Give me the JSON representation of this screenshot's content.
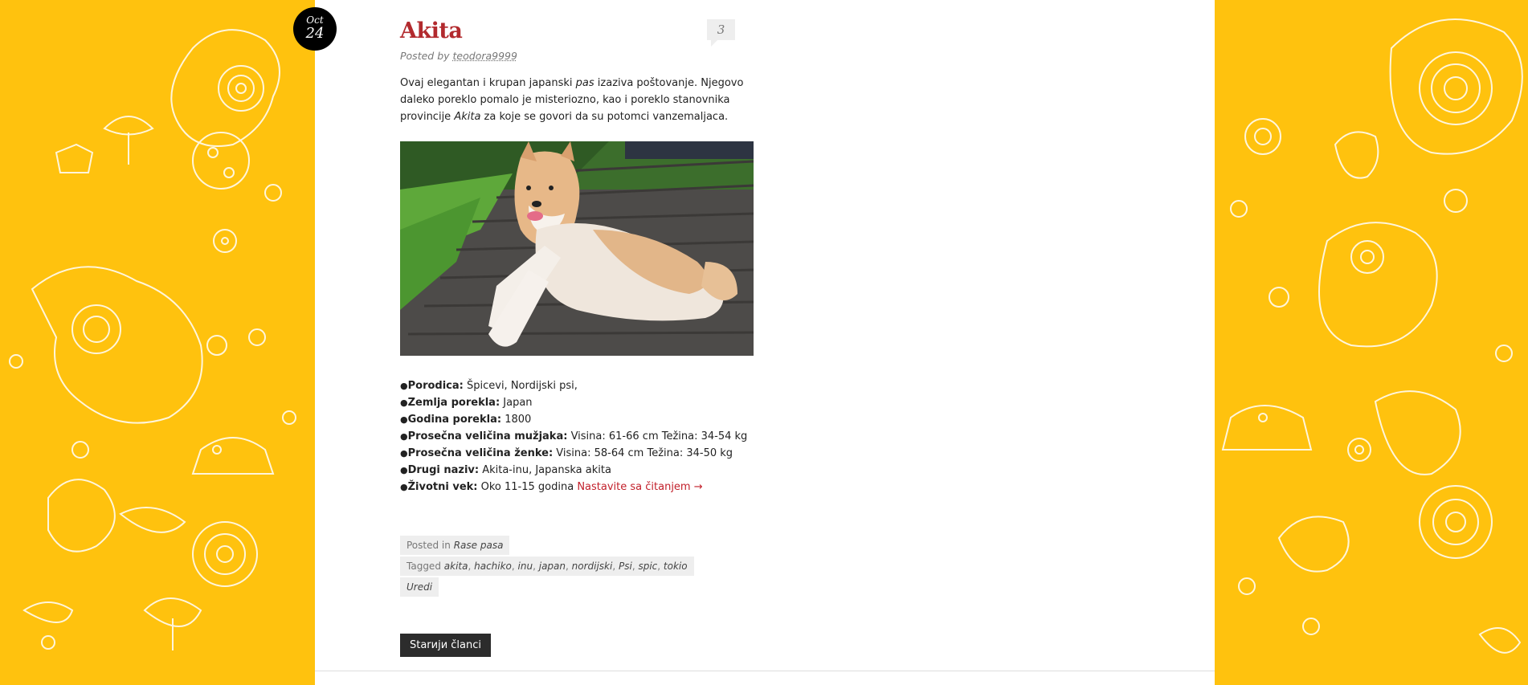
{
  "post": {
    "date_month": "Oct",
    "date_day": "24",
    "title": "Akita",
    "posted_by_label": "Posted by",
    "author": "teodora9999",
    "comment_count": "3",
    "intro": {
      "t1": "Ovaj elegantan i krupan japanski ",
      "em1": "pas",
      "t2": " izaziva poštovanje. Njegovo daleko poreklo pomalo je misteriozno, kao i poreklo stanovnika provincije ",
      "em2": "Akita",
      "t3": " za koje se govori da su potomci vanzemaljaca."
    },
    "facts": [
      {
        "label": "Porodica:",
        "value": " Špicevi, Nordijski psi,"
      },
      {
        "label": "Zemlja porekla:",
        "value": " Japan"
      },
      {
        "label": "Godina porekla:",
        "value": " 1800"
      },
      {
        "label": "Prosečna veličina mužjaka:",
        "value": " Visina: 61-66 cm Težina: 34-54 kg"
      },
      {
        "label": "Prosečna veličina ženke:",
        "value": " Visina: 58-64 cm Težina: 34-50 kg"
      },
      {
        "label": "Drugi naziv:",
        "value": " Akita-inu, Japanska akita"
      },
      {
        "label": "Životni vek:",
        "value": " Oko 11-15 godina "
      }
    ],
    "read_more": "Nastavite sa čitanjem →",
    "posted_in_label": "Posted in",
    "category": "Rase pasa",
    "tagged_label": "Tagged",
    "tags": [
      "akita",
      "hachiko",
      "inu",
      "japan",
      "nordijski",
      "Psi",
      "spic",
      "tokio"
    ],
    "edit_label": "Uredi"
  },
  "nav": {
    "older_label": "Starији članci"
  },
  "colors": {
    "background": "#ffc20e",
    "accent": "#b22a2e",
    "link": "#c21f2a"
  }
}
